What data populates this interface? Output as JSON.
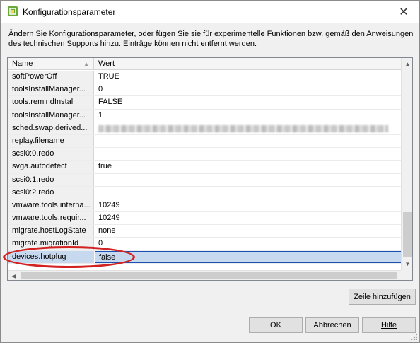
{
  "window": {
    "title": "Konfigurationsparameter",
    "close_glyph": "✕"
  },
  "description": "Ändern Sie Konfigurationsparameter, oder fügen Sie sie für experimentelle Funktionen bzw. gemäß den Anweisungen des technischen Supports hinzu. Einträge können nicht entfernt werden.",
  "table": {
    "columns": [
      "Name",
      "Wert"
    ],
    "sort_glyph": "▲",
    "rows": [
      {
        "name": "softPowerOff",
        "value": "TRUE"
      },
      {
        "name": "toolsInstallManager...",
        "value": "0"
      },
      {
        "name": "tools.remindInstall",
        "value": "FALSE"
      },
      {
        "name": "toolsInstallManager...",
        "value": "1"
      },
      {
        "name": "sched.swap.derived...",
        "value": ""
      },
      {
        "name": "replay.filename",
        "value": ""
      },
      {
        "name": "scsi0:0.redo",
        "value": ""
      },
      {
        "name": "svga.autodetect",
        "value": "true"
      },
      {
        "name": "scsi0:1.redo",
        "value": ""
      },
      {
        "name": "scsi0:2.redo",
        "value": ""
      },
      {
        "name": "vmware.tools.interna...",
        "value": "10249"
      },
      {
        "name": "vmware.tools.requir...",
        "value": "10249"
      },
      {
        "name": "migrate.hostLogState",
        "value": "none"
      },
      {
        "name": "migrate.migrationId",
        "value": "0"
      },
      {
        "name": "devices.hotplug",
        "value": "false"
      }
    ],
    "selected_row_name": "devices.hotplug"
  },
  "scroll_glyphs": {
    "up": "▲",
    "down": "▼",
    "left": "◀"
  },
  "buttons": {
    "add_row": "Zeile hinzufügen",
    "ok": "OK",
    "cancel": "Abbrechen",
    "help": "Hilfe"
  },
  "colors": {
    "selection": "#c7d9ef",
    "selection_border": "#1c52b3",
    "annotation_ellipse": "#d32222",
    "app_icon": "#5b9d2a"
  }
}
